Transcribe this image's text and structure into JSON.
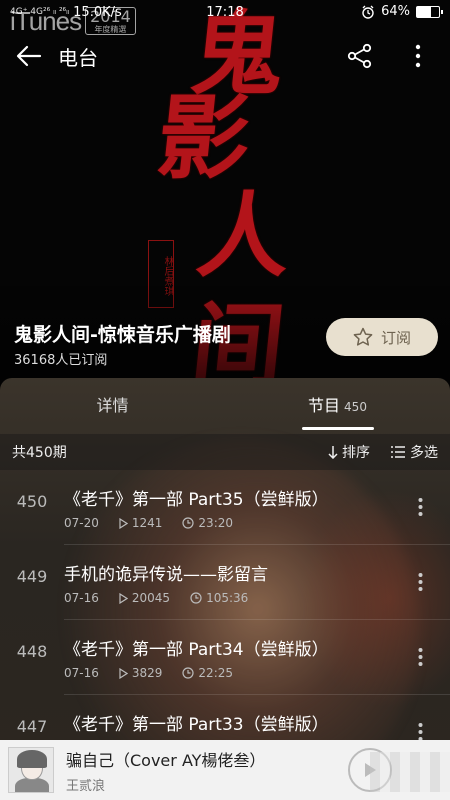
{
  "status_bar": {
    "network_tags": "4G⁺ 4G²⁶ ₗₗ ²⁶ₗₗ",
    "speed": "15.0K/s",
    "time": "17:18",
    "battery": "64%",
    "battery_level": 0.64
  },
  "watermark": {
    "word": "iTunes",
    "year": "2014",
    "caption": "年度精選"
  },
  "header": {
    "title": "电台"
  },
  "cover_art": {
    "chars": [
      "鬼",
      "影",
      "人",
      "间"
    ],
    "seal": "林后煮琪"
  },
  "album": {
    "title": "鬼影人间-惊悚音乐广播剧",
    "subscribers": "36168人已订阅",
    "subscribe_label": "订阅"
  },
  "tabs": [
    {
      "label": "详情",
      "count": ""
    },
    {
      "label": "节目",
      "count": "450"
    }
  ],
  "toolbar": {
    "total": "共450期",
    "sort_label": "排序",
    "multi_label": "多选"
  },
  "episodes": [
    {
      "num": "450",
      "title": "《老千》第一部 Part35（尝鲜版）",
      "date": "07-20",
      "plays": "1241",
      "duration": "23:20"
    },
    {
      "num": "449",
      "title": "手机的诡异传说——影留言",
      "date": "07-16",
      "plays": "20045",
      "duration": "105:36"
    },
    {
      "num": "448",
      "title": "《老千》第一部 Part34（尝鲜版）",
      "date": "07-16",
      "plays": "3829",
      "duration": "22:25"
    },
    {
      "num": "447",
      "title": "《老千》第一部 Part33（尝鲜版）",
      "date": "",
      "plays": "",
      "duration": ""
    }
  ],
  "player": {
    "title": "骗自己（Cover AY楊佬叁）",
    "artist": "王贰浪"
  },
  "colors": {
    "accent_red": "#b3141a",
    "subscribe_bg": "#e8e0cf",
    "panel_bg": "#2c2620"
  }
}
